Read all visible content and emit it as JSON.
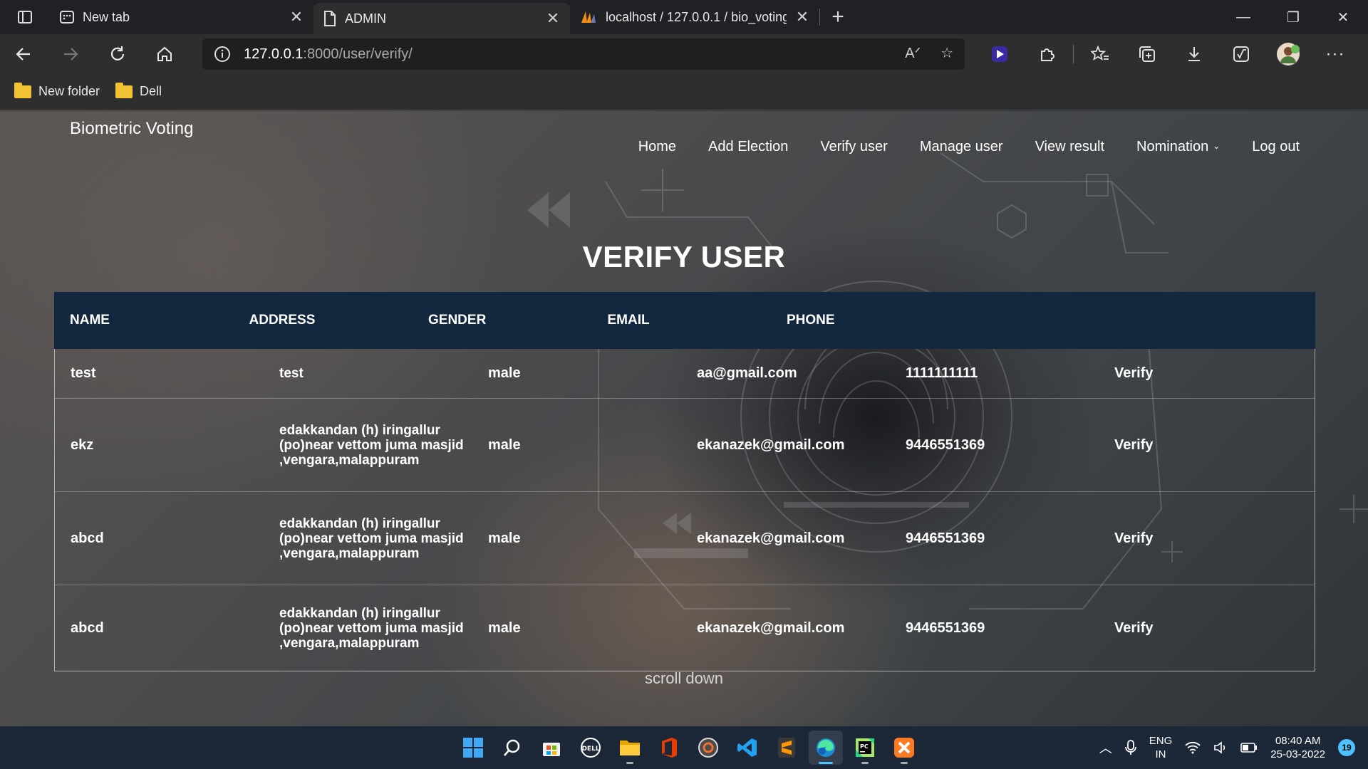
{
  "browser": {
    "tabs": [
      {
        "title": "New tab"
      },
      {
        "title": "ADMIN"
      },
      {
        "title": "localhost / 127.0.0.1 / bio_voting"
      }
    ],
    "address": {
      "host": "127.0.0.1",
      "path": ":8000/user/verify/"
    },
    "bookmarks": [
      {
        "label": "New folder"
      },
      {
        "label": "Dell"
      }
    ]
  },
  "site": {
    "brand": "Biometric Voting",
    "nav": {
      "home": "Home",
      "add_election": "Add Election",
      "verify_user": "Verify user",
      "manage_user": "Manage user",
      "view_result": "View result",
      "nomination": "Nomination",
      "logout": "Log out"
    },
    "heading": "VERIFY USER",
    "table": {
      "headers": [
        "NAME",
        "ADDRESS",
        "GENDER",
        "EMAIL",
        "PHONE"
      ],
      "rows": [
        {
          "name": "test",
          "address": "test",
          "gender": "male",
          "email": "aa@gmail.com",
          "phone": "1111111111",
          "action": "Verify"
        },
        {
          "name": "ekz",
          "address": "edakkandan (h) iringallur (po)near vettom juma masjid ,vengara,malappuram",
          "gender": "male",
          "email": "ekanazek@gmail.com",
          "phone": "9446551369",
          "action": "Verify"
        },
        {
          "name": "abcd",
          "address": "edakkandan (h) iringallur (po)near vettom juma masjid ,vengara,malappuram",
          "gender": "male",
          "email": "ekanazek@gmail.com",
          "phone": "9446551369",
          "action": "Verify"
        },
        {
          "name": "abcd",
          "address": "edakkandan (h) iringallur (po)near vettom juma masjid ,vengara,malappuram",
          "gender": "male",
          "email": "ekanazek@gmail.com",
          "phone": "9446551369",
          "action": "Verify"
        }
      ]
    },
    "scroll_hint": "scroll down"
  },
  "taskbar": {
    "apps": [
      "start-icon",
      "search-icon",
      "store-icon",
      "dell-icon",
      "file-explorer-icon",
      "office-icon",
      "media-icon",
      "vscode-icon",
      "sublime-icon",
      "edge-icon",
      "pycharm-icon",
      "xampp-icon"
    ],
    "lang_top": "ENG",
    "lang_bottom": "IN",
    "time": "08:40 AM",
    "date": "25-03-2022",
    "notification_count": "19"
  },
  "colors": {
    "table_header": "#13283e",
    "taskbar": "#1c2738",
    "accent": "#4cc2ff"
  }
}
